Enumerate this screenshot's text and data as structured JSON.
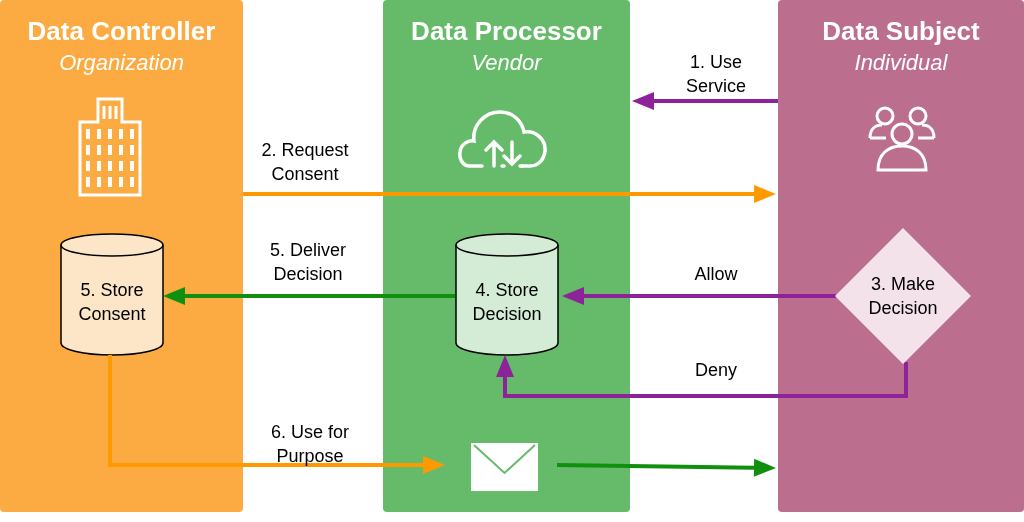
{
  "lanes": [
    {
      "title": "Data Controller",
      "subtitle": "Organization",
      "color": "#fbab41"
    },
    {
      "title": "Data Processor",
      "subtitle": "Vendor",
      "color": "#66bb6a"
    },
    {
      "title": "Data Subject",
      "subtitle": "Individual",
      "color": "#bc6e8f"
    }
  ],
  "stores": [
    {
      "label": "5. Store Consent",
      "color": "#fde6c7"
    },
    {
      "label": "4. Store Decision",
      "color": "#d4ecd5"
    }
  ],
  "decision": {
    "label": "3. Make Decision"
  },
  "edges": [
    {
      "label": "1. Use Service",
      "color": "#8e2399"
    },
    {
      "label": "2. Request Consent",
      "color": "#ff9900"
    },
    {
      "label": "5. Deliver Decision",
      "color": "#11900f"
    },
    {
      "label": "Allow",
      "color": "#8e2399"
    },
    {
      "label": "Deny",
      "color": "#8e2399"
    },
    {
      "label": "6. Use for Purpose",
      "color": "#ff9900"
    },
    {
      "color": "#11900f"
    }
  ]
}
